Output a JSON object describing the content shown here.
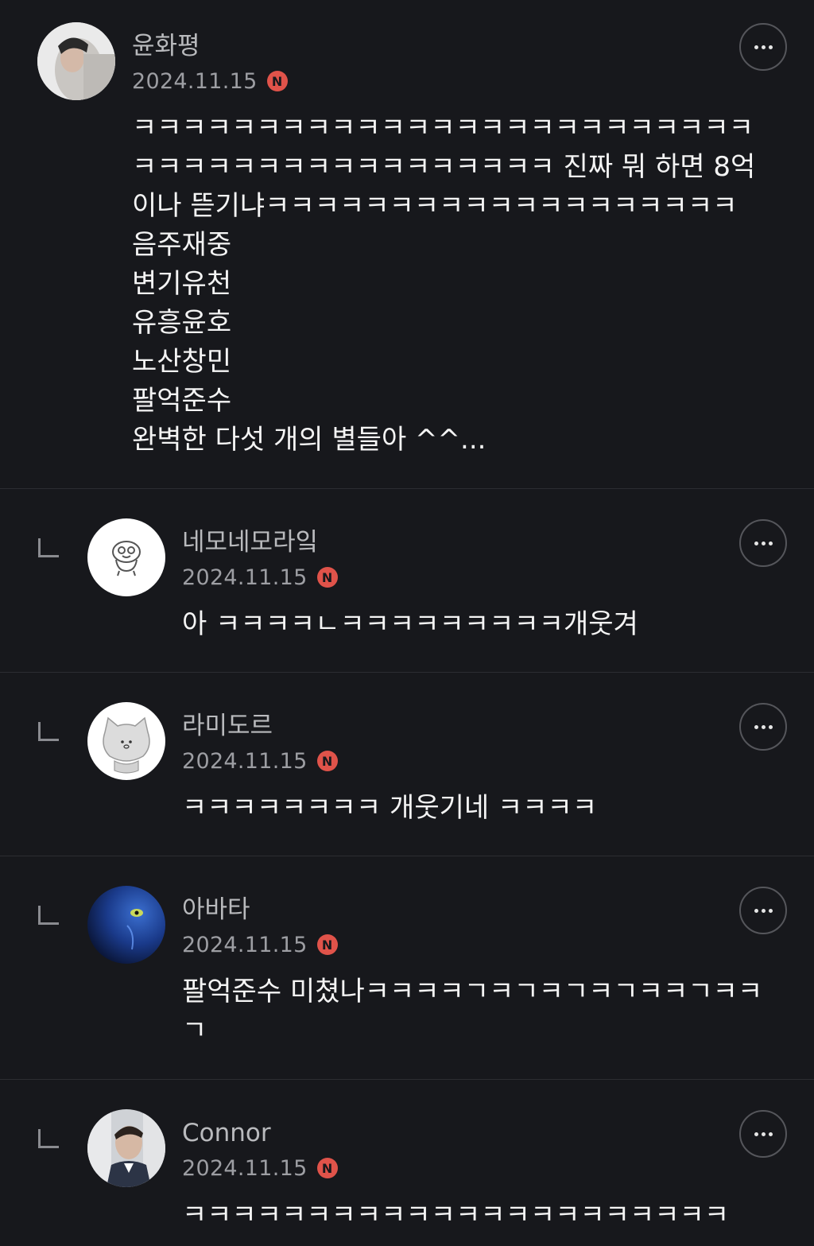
{
  "comments": [
    {
      "author": "윤화평",
      "date": "2024.11.15",
      "badge": "N",
      "avatar": "profile-photo-man",
      "lines": [
        "ㅋㅋㅋㅋㅋㅋㅋㅋㅋㅋㅋㅋㅋㅋㅋㅋㅋㅋㅋㅋㅋㅋㅋㅋㅋ",
        "ㅋㅋㅋㅋㅋㅋㅋㅋㅋㅋㅋㅋㅋㅋㅋㅋㅋ 진짜 뭐 하면 8억",
        "이나 뜯기냐ㅋㅋㅋㅋㅋㅋㅋㅋㅋㅋㅋㅋㅋㅋㅋㅋㅋㅋㅋ",
        "음주재중",
        "변기유천",
        "유흥윤호",
        "노산창민",
        "팔억준수",
        "완벽한 다섯 개의 별들아 ^^..."
      ]
    },
    {
      "author": "네모네모라잌",
      "date": "2024.11.15",
      "badge": "N",
      "avatar": "cartoon-character",
      "lines": [
        "아 ㅋㅋㅋㅋㄴㅋㅋㅋㅋㅋㅋㅋㅋㅋ개웃겨"
      ]
    },
    {
      "author": "라미도르",
      "date": "2024.11.15",
      "badge": "N",
      "avatar": "cartoon-cat",
      "lines": [
        "ㅋㅋㅋㅋㅋㅋㅋㅋ 개웃기네 ㅋㅋㅋㅋ"
      ]
    },
    {
      "author": "아바타",
      "date": "2024.11.15",
      "badge": "N",
      "avatar": "avatar-blue-face",
      "lines": [
        "팔억준수 미쳤나ㅋㅋㅋㅋㄱㅋㄱㅋㄱㅋㄱㅋㅋㄱㅋㅋ",
        "ㄱ"
      ]
    },
    {
      "author": "Connor",
      "date": "2024.11.15",
      "badge": "N",
      "avatar": "profile-photo-connor",
      "lines": [
        "ㅋㅋㅋㅋㅋㅋㅋㅋㅋㅋㅋㅋㅋㅋㅋㅋㅋㅋㅋㅋㅋㅋ"
      ]
    }
  ],
  "colors": {
    "background": "#17181c",
    "badge": "#e0534a",
    "divider": "#2c2d32"
  }
}
